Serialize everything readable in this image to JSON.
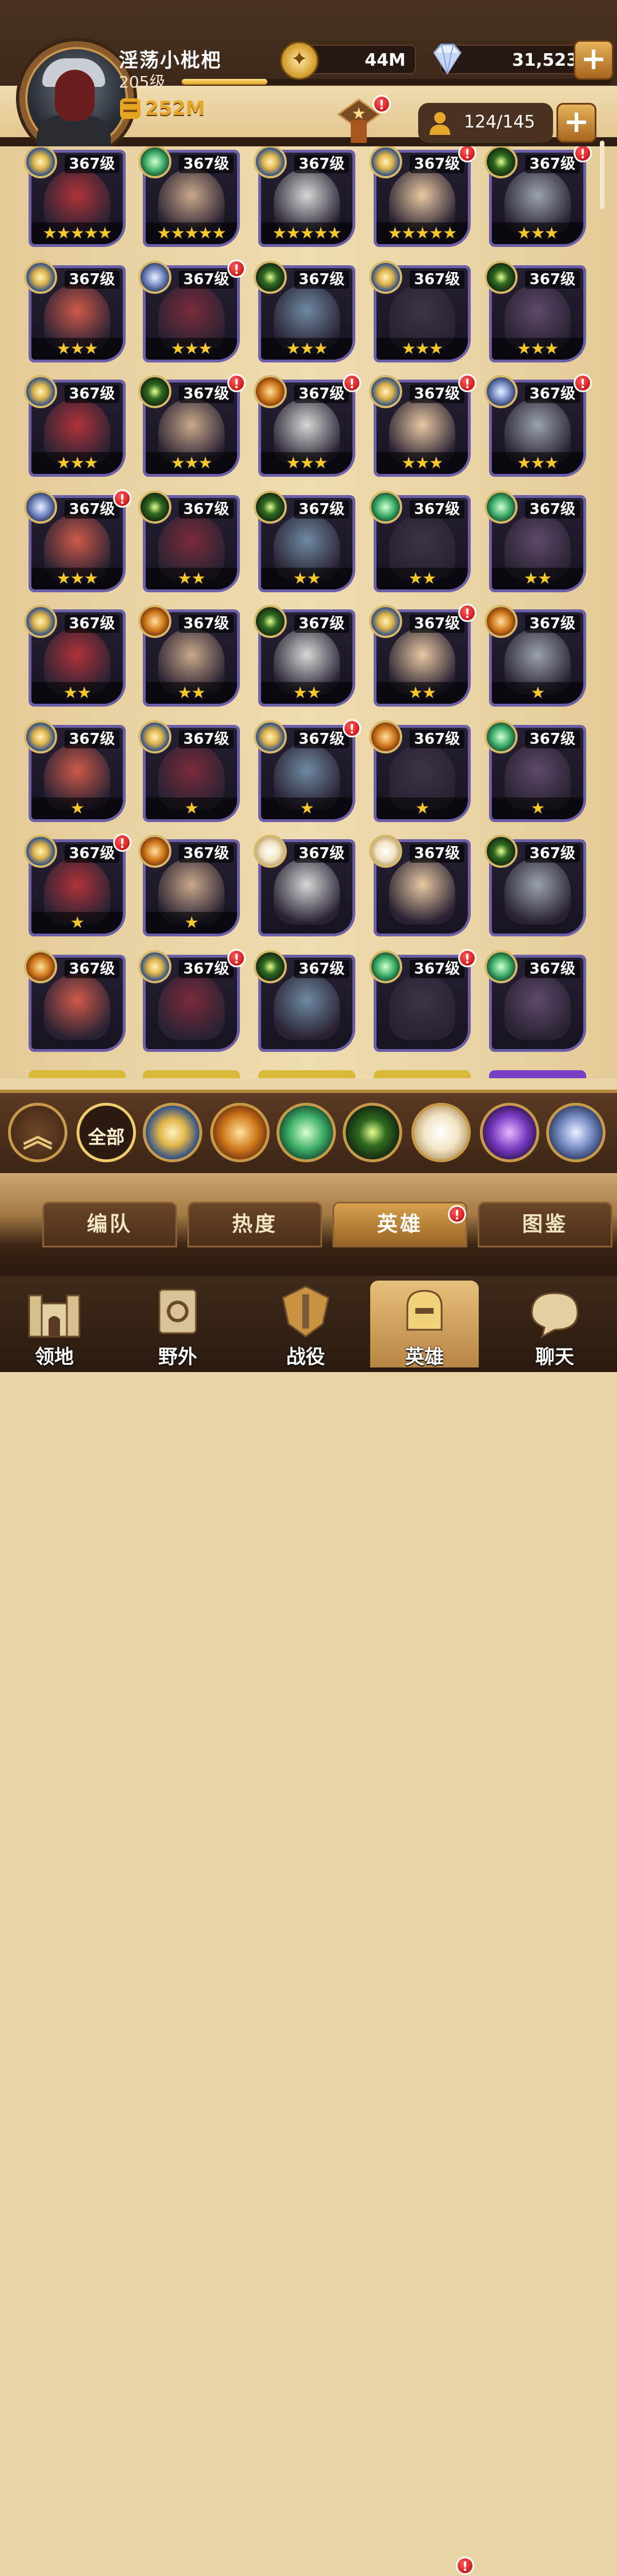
{
  "player": {
    "name": "淫荡小枇杷",
    "level": "205级",
    "xp_fraction": 0.2,
    "power": "252M"
  },
  "currency": {
    "gold": "44M",
    "gems": "31,523"
  },
  "roster": {
    "count": "124/145"
  },
  "colors": {
    "card_border": "#6c5fa8",
    "star": "#f6c929",
    "notification": "#d11a1a"
  },
  "hero_rows": [
    [
      {
        "level": "367级",
        "stars": "★★★★★",
        "faction": "lightbearer",
        "dot": false
      },
      {
        "level": "367级",
        "stars": "★★★★★",
        "faction": "wilder",
        "dot": false
      },
      {
        "level": "367级",
        "stars": "★★★★★",
        "faction": "lightbearer",
        "dot": false
      },
      {
        "level": "367级",
        "stars": "★★★★★",
        "faction": "lightbearer",
        "dot": true
      },
      {
        "level": "367级",
        "stars": "★★★",
        "faction": "graveborn",
        "dot": true
      }
    ],
    [
      {
        "level": "367级",
        "stars": "★★★",
        "faction": "lightbearer",
        "dot": false
      },
      {
        "level": "367级",
        "stars": "★★★",
        "faction": "dimensional",
        "dot": true
      },
      {
        "level": "367级",
        "stars": "★★★",
        "faction": "graveborn",
        "dot": false
      },
      {
        "level": "367级",
        "stars": "★★★",
        "faction": "lightbearer",
        "dot": false
      },
      {
        "level": "367级",
        "stars": "★★★",
        "faction": "graveborn",
        "dot": false
      }
    ],
    [
      {
        "level": "367级",
        "stars": "★★★",
        "faction": "lightbearer",
        "dot": false
      },
      {
        "level": "367级",
        "stars": "★★★",
        "faction": "graveborn",
        "dot": true
      },
      {
        "level": "367级",
        "stars": "★★★",
        "faction": "mauler",
        "dot": true
      },
      {
        "level": "367级",
        "stars": "★★★",
        "faction": "lightbearer",
        "dot": true
      },
      {
        "level": "367级",
        "stars": "★★★",
        "faction": "dimensional",
        "dot": true
      }
    ],
    [
      {
        "level": "367级",
        "stars": "★★★",
        "faction": "dimensional",
        "dot": true
      },
      {
        "level": "367级",
        "stars": "★★",
        "faction": "graveborn",
        "dot": false
      },
      {
        "level": "367级",
        "stars": "★★",
        "faction": "graveborn",
        "dot": false
      },
      {
        "level": "367级",
        "stars": "★★",
        "faction": "wilder",
        "dot": false
      },
      {
        "level": "367级",
        "stars": "★★",
        "faction": "wilder",
        "dot": false
      }
    ],
    [
      {
        "level": "367级",
        "stars": "★★",
        "faction": "lightbearer",
        "dot": false
      },
      {
        "level": "367级",
        "stars": "★★",
        "faction": "mauler",
        "dot": false
      },
      {
        "level": "367级",
        "stars": "★★",
        "faction": "graveborn",
        "dot": false
      },
      {
        "level": "367级",
        "stars": "★★",
        "faction": "lightbearer",
        "dot": true
      },
      {
        "level": "367级",
        "stars": "★",
        "faction": "mauler",
        "dot": false
      }
    ],
    [
      {
        "level": "367级",
        "stars": "★",
        "faction": "lightbearer",
        "dot": false
      },
      {
        "level": "367级",
        "stars": "★",
        "faction": "lightbearer",
        "dot": false
      },
      {
        "level": "367级",
        "stars": "★",
        "faction": "lightbearer",
        "dot": true
      },
      {
        "level": "367级",
        "stars": "★",
        "faction": "mauler",
        "dot": false
      },
      {
        "level": "367级",
        "stars": "★",
        "faction": "wilder",
        "dot": false
      }
    ],
    [
      {
        "level": "367级",
        "stars": "★",
        "faction": "lightbearer",
        "dot": true
      },
      {
        "level": "367级",
        "stars": "★",
        "faction": "mauler",
        "dot": false
      },
      {
        "level": "367级",
        "stars": "",
        "faction": "celestial",
        "dot": false
      },
      {
        "level": "367级",
        "stars": "",
        "faction": "celestial",
        "dot": false
      },
      {
        "level": "367级",
        "stars": "",
        "faction": "graveborn",
        "dot": false
      }
    ],
    [
      {
        "level": "367级",
        "stars": "",
        "faction": "mauler",
        "dot": false
      },
      {
        "level": "367级",
        "stars": "",
        "faction": "lightbearer",
        "dot": true
      },
      {
        "level": "367级",
        "stars": "",
        "faction": "graveborn",
        "dot": false
      },
      {
        "level": "367级",
        "stars": "",
        "faction": "wilder",
        "dot": true
      },
      {
        "level": "367级",
        "stars": "",
        "faction": "wilder",
        "dot": false
      }
    ]
  ],
  "filter": {
    "all_label": "全部",
    "factions": [
      "lightbearer",
      "mauler",
      "wilder",
      "graveborn",
      "celestial",
      "hypogean",
      "dimensional"
    ]
  },
  "tabs": [
    {
      "label": "编队"
    },
    {
      "label": "热度"
    },
    {
      "label": "英雄"
    },
    {
      "label": "图鉴"
    }
  ],
  "nav": [
    {
      "label": "领地",
      "icon": "castle-icon"
    },
    {
      "label": "野外",
      "icon": "map-scroll-icon"
    },
    {
      "label": "战役",
      "icon": "campaign-crest-icon"
    },
    {
      "label": "英雄",
      "icon": "hero-helmet-icon"
    },
    {
      "label": "聊天",
      "icon": "chat-bubble-icon"
    }
  ],
  "notif_mark": "!"
}
